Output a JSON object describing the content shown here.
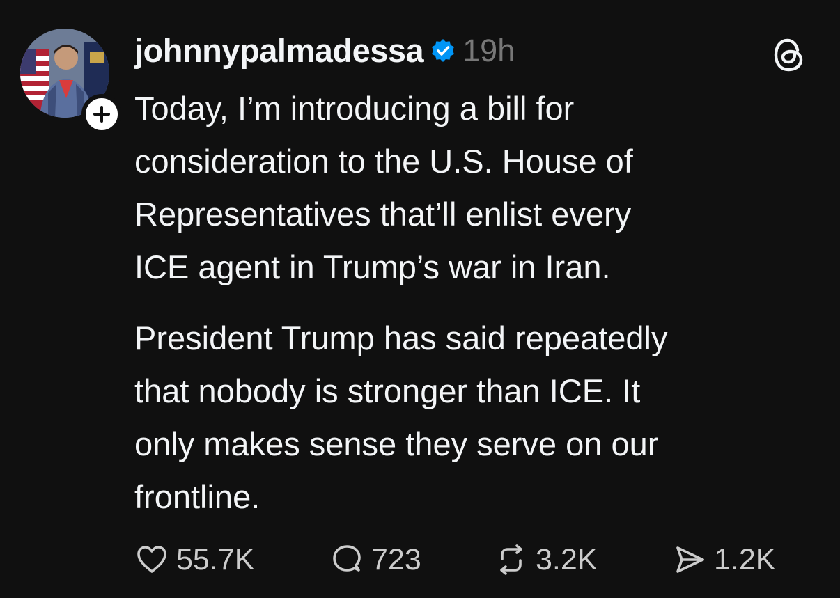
{
  "post": {
    "username": "johnnypalmadessa",
    "verified": true,
    "timestamp": "19h",
    "paragraphs": [
      "Today, I’m introducing a bill for\nconsideration to the U.S. House of\nRepresentatives that’ll enlist every\nICE agent in Trump’s war in Iran.",
      "President Trump has said repeatedly\nthat nobody is stronger than ICE. It\nonly makes sense they serve on our\nfrontline."
    ],
    "actions": {
      "likes": "55.7K",
      "replies": "723",
      "reposts": "3.2K",
      "shares": "1.2K"
    }
  },
  "icons": {
    "avatar": "user-avatar",
    "follow": "plus-icon",
    "verified": "verified-badge-icon",
    "app": "threads-logo-icon",
    "like": "heart-icon",
    "reply": "comment-bubble-icon",
    "repost": "repost-arrows-icon",
    "share": "send-icon"
  },
  "colors": {
    "background": "#101010",
    "text": "#f3f5f7",
    "muted": "#777777",
    "verified": "#0095f6"
  }
}
